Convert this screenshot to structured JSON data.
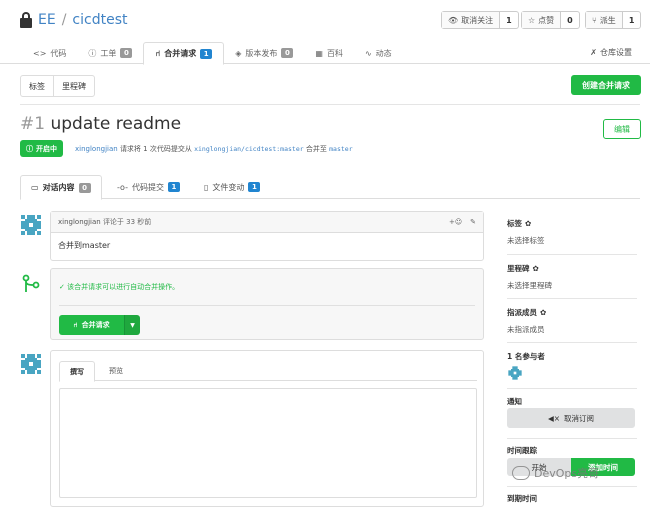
{
  "repo": {
    "owner": "EE",
    "separator": "/",
    "name": "cicdtest"
  },
  "header_buttons": [
    {
      "icon": "eye-icon",
      "label": "取消关注",
      "count": "1"
    },
    {
      "icon": "star-icon",
      "label": "点赞",
      "count": "0"
    },
    {
      "icon": "fork-icon",
      "label": "派生",
      "count": "1"
    }
  ],
  "repo_tabs": [
    {
      "icon": "code-icon",
      "label": "代码",
      "badge": ""
    },
    {
      "icon": "issue-icon",
      "label": "工单",
      "badge": "0"
    },
    {
      "icon": "pull-request-icon",
      "label": "合并请求",
      "badge": "1"
    },
    {
      "icon": "release-icon",
      "label": "版本发布",
      "badge": "0"
    },
    {
      "icon": "wiki-icon",
      "label": "百科",
      "badge": ""
    },
    {
      "icon": "activity-icon",
      "label": "动态",
      "badge": ""
    }
  ],
  "settings_label": "仓库设置",
  "subnav": {
    "labels": "标签",
    "milestones": "里程碑"
  },
  "create_pr_label": "创建合并请求",
  "pr": {
    "number": "#1",
    "title": "update readme",
    "edit_label": "编辑",
    "status": "开启中",
    "author": "xinglongjian",
    "meta_mid": "请求将 1 次代码提交从",
    "from_branch": "xinglongjian/cicdtest:master",
    "meta_into": "合并至",
    "to_branch": "master"
  },
  "conversation_tabs": [
    {
      "icon": "comments-icon",
      "label": "对话内容",
      "count": "0"
    },
    {
      "icon": "commit-icon",
      "label": "代码提交",
      "count": "1"
    },
    {
      "icon": "file-icon",
      "label": "文件变动",
      "count": "1"
    }
  ],
  "comment": {
    "author": "xinglongjian",
    "time": "评论于 33 秒前",
    "body": "合并到master",
    "reaction": "+☺"
  },
  "merge": {
    "message": "该合并请求可以进行自动合并操作。",
    "button": "合并请求"
  },
  "editor": {
    "tab_write": "撰写",
    "tab_preview": "预览"
  },
  "sidebar": {
    "labels_title": "标签",
    "labels_value": "未选择标签",
    "milestone_title": "里程碑",
    "milestone_value": "未选择里程碑",
    "assignees_title": "指派成员",
    "assignees_value": "未指派成员",
    "participants_title": "1 名参与者",
    "notify_title": "通知",
    "unsubscribe_label": "取消订阅",
    "time_title": "时间跟踪",
    "start_label": "开始",
    "add_time_label": "添加时间",
    "due_title": "到期时间"
  },
  "watermark": "DevOps亮哥",
  "colors": {
    "green": "#21ba45",
    "blue": "#2185d0",
    "link": "#4183c4"
  }
}
